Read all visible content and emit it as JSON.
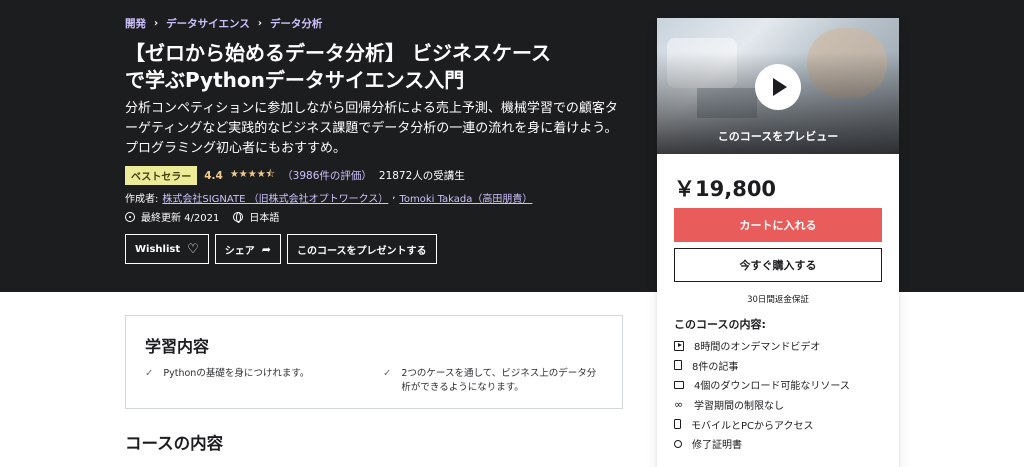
{
  "breadcrumb": [
    "開発",
    "データサイエンス",
    "データ分析"
  ],
  "breadcrumb_sep": "›",
  "course": {
    "title_line1": "【ゼロから始めるデータ分析】 ビジネスケース",
    "title_line2": "で学ぶPythonデータサイエンス入門",
    "subtitle": "分析コンペティションに参加しながら回帰分析による売上予測、機械学習での顧客ターゲティングなど実践的なビジネス課題でデータ分析の一連の流れを身に着けよう。 プログラミング初心者にもおすすめ。",
    "badge": "ベストセラー",
    "rating": "4.4",
    "stars": "★★★★⯪",
    "rating_count": "（3986件の評価）",
    "students": "21872人の受講生",
    "authors_label": "作成者:",
    "author1": "株式会社SIGNATE （旧株式会社オプトワークス）",
    "author_sep": ",",
    "author2": "Tomoki Takada（高田朋貴）",
    "last_updated": "最終更新 4/2021",
    "language": "日本語"
  },
  "actions": {
    "wishlist": "Wishlist",
    "wishlist_icon": "♡",
    "share": "シェア",
    "share_icon": "➦",
    "gift": "このコースをプレゼントする"
  },
  "sidebar": {
    "preview_label": "このコースをプレビュー",
    "price": "￥19,800",
    "add_to_cart": "カートに入れる",
    "buy_now": "今すぐ購入する",
    "guarantee": "30日間返金保証",
    "includes_title": "このコースの内容:",
    "includes": [
      {
        "icon": "video-icon",
        "label": "8時間のオンデマンドビデオ"
      },
      {
        "icon": "file-icon",
        "label": "8件の記事"
      },
      {
        "icon": "download-icon",
        "label": "4個のダウンロード可能なリソース"
      },
      {
        "icon": "infinity-icon",
        "label": "学習期間の制限なし"
      },
      {
        "icon": "mobile-icon",
        "label": "モバイルとPCからアクセス"
      },
      {
        "icon": "certificate-icon",
        "label": "修了証明書"
      }
    ]
  },
  "learn": {
    "title": "学習内容",
    "check": "✓",
    "items": [
      "Pythonの基礎を身につけれます。",
      "2つのケースを通して、ビジネス上のデータ分析ができるようになります。"
    ]
  },
  "content_title": "コースの内容",
  "colors": {
    "hero_bg": "#1c1d1f",
    "link_purple": "#cec0fc",
    "star_gold": "#f3ca8c",
    "badge_bg": "#eceb98",
    "cart_red": "#e85c5c"
  }
}
